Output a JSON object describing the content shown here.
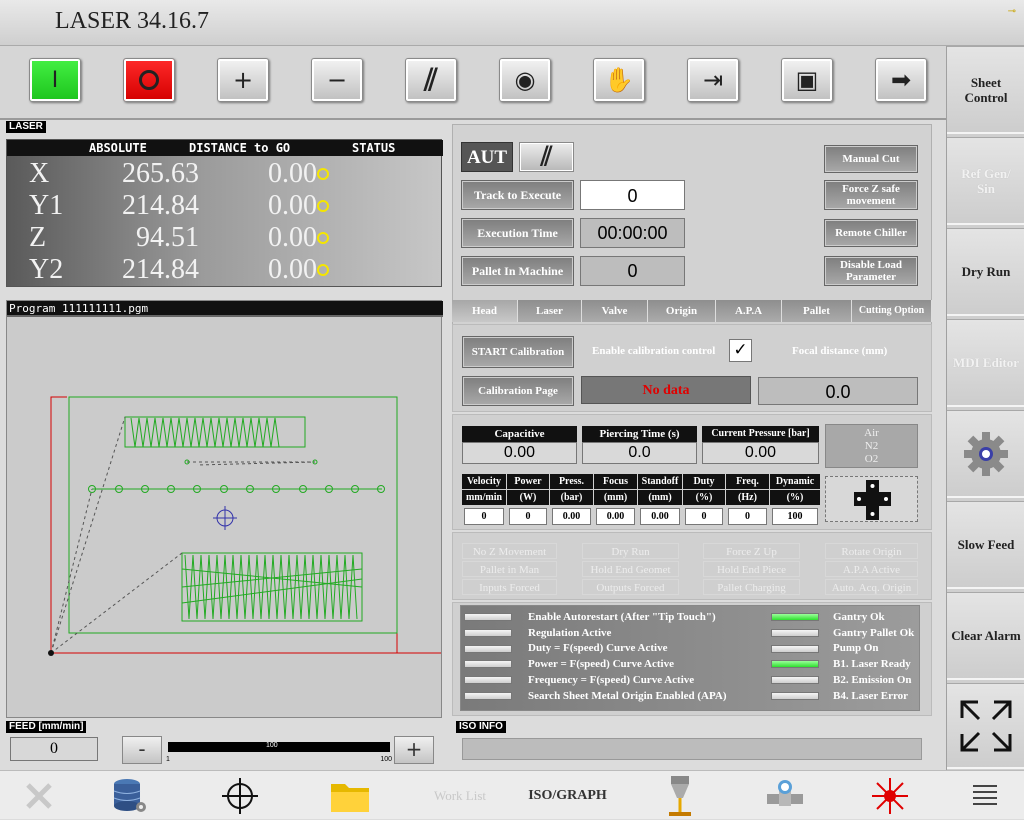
{
  "app": {
    "title": "LASER 34.16.7"
  },
  "toolbar": {
    "buttons": [
      {
        "name": "start-button",
        "glyph": "I"
      },
      {
        "name": "stop-button",
        "glyph": "O"
      },
      {
        "name": "plus-button",
        "glyph": "+"
      },
      {
        "name": "minus-button",
        "glyph": "−"
      },
      {
        "name": "slash-button",
        "glyph": "⫽"
      },
      {
        "name": "origin-button",
        "glyph": "◉"
      },
      {
        "name": "hand-button",
        "glyph": "✋"
      },
      {
        "name": "step-button",
        "glyph": "⇥"
      },
      {
        "name": "hand-exit-button",
        "glyph": "▶"
      },
      {
        "name": "exit-button",
        "glyph": "➜"
      }
    ]
  },
  "right_sidebar": [
    {
      "label": "Sheet\nControl",
      "enabled": true
    },
    {
      "label": "Ref Gen/\nSin",
      "enabled": false
    },
    {
      "label": "Dry Run",
      "enabled": true
    },
    {
      "label": "MDI Editor",
      "enabled": false
    },
    {
      "label": "",
      "icon": "gear-icon",
      "enabled": true
    },
    {
      "label": "Slow Feed",
      "enabled": true
    },
    {
      "label": "Clear Alarm",
      "enabled": true
    },
    {
      "label": "",
      "icon": "expand-icon",
      "enabled": true
    }
  ],
  "laser_panel": {
    "title": "LASER",
    "headers": [
      "ABSOLUTE",
      "DISTANCE to GO",
      "STATUS"
    ],
    "axes": [
      {
        "name": "X",
        "abs": "265.63",
        "dist": "0.00"
      },
      {
        "name": "Y1",
        "abs": "214.84",
        "dist": "0.00"
      },
      {
        "name": "Z",
        "abs": "94.51",
        "dist": "0.00"
      },
      {
        "name": "Y2",
        "abs": "214.84",
        "dist": "0.00"
      }
    ],
    "status_color": "#f5e600"
  },
  "program": {
    "title": "Program 111111111.pgm"
  },
  "feed": {
    "label": "FEED [mm/min]",
    "value": "0",
    "minus": "-",
    "plus": "+",
    "slider_value": "100",
    "slider_min": "1",
    "slider_max": "100"
  },
  "exec": {
    "mode": "AUT",
    "track_label": "Track to Execute",
    "track_value": "0",
    "time_label": "Execution Time",
    "time_value": "00:00:00",
    "pallet_label": "Pallet In Machine",
    "pallet_value": "0",
    "buttons": [
      "Manual Cut",
      "Force Z safe movement",
      "Remote Chiller",
      "Disable Load Parameter"
    ]
  },
  "tabs": [
    "Head",
    "Laser",
    "Valve",
    "Origin",
    "A.P.A",
    "Pallet",
    "Cutting Option"
  ],
  "head": {
    "start_cal": "START Calibration",
    "enable_cal": "Enable calibration control",
    "enable_cal_checked": true,
    "focal_label": "Focal distance (mm)",
    "cal_page": "Calibration Page",
    "no_data": "No data",
    "focal_value": "0.0"
  },
  "sensors": {
    "capacitive_label": "Capacitive",
    "capacitive": "0.00",
    "piercing_label": "Piercing Time (s)",
    "piercing": "0.0",
    "pressure_label": "Current Pressure [bar]",
    "pressure": "0.00",
    "gases": [
      "Air",
      "N2",
      "O2"
    ]
  },
  "params": {
    "headers": [
      [
        "Velocity",
        "mm/min"
      ],
      [
        "Power",
        "(W)"
      ],
      [
        "Press.",
        "(bar)"
      ],
      [
        "Focus",
        "(mm)"
      ],
      [
        "Standoff",
        "(mm)"
      ],
      [
        "Duty",
        "(%)"
      ],
      [
        "Freq.",
        "(Hz)"
      ],
      [
        "Dynamic",
        "(%)"
      ]
    ],
    "values": [
      "0",
      "0",
      "0.00",
      "0.00",
      "0.00",
      "0",
      "0",
      "100"
    ]
  },
  "options": [
    [
      "No Z Movement",
      "Dry Run",
      "Force Z Up",
      "Rotate Origin"
    ],
    [
      "Pallet in Man",
      "Hold End Geomet",
      "Hold End Piece",
      "A.P.A  Active"
    ],
    [
      "Inputs Forced",
      "Outputs Forced",
      "Pallet Charging",
      "Auto. Acq. Origin"
    ]
  ],
  "status_left": [
    {
      "label": "Enable Autorestart (After \"Tip Touch\")",
      "on": false
    },
    {
      "label": "Regulation Active",
      "on": false
    },
    {
      "label": "Duty = F(speed) Curve Active",
      "on": false
    },
    {
      "label": "Power = F(speed) Curve Active",
      "on": false
    },
    {
      "label": "Frequency = F(speed) Curve Active",
      "on": false
    },
    {
      "label": "Search Sheet Metal Origin Enabled (APA)",
      "on": false
    }
  ],
  "status_right": [
    {
      "label": "Gantry Ok",
      "on": true
    },
    {
      "label": "Gantry Pallet Ok",
      "on": false
    },
    {
      "label": "Pump On",
      "on": false
    },
    {
      "label": "B1. Laser Ready",
      "on": true
    },
    {
      "label": "B2. Emission On",
      "on": false
    },
    {
      "label": "B4. Laser Error",
      "on": false
    }
  ],
  "iso": {
    "label": "ISO INFO"
  },
  "bottom": [
    {
      "name": "close-button",
      "label": "",
      "icon": "close-icon"
    },
    {
      "name": "database-button",
      "label": "",
      "icon": "database-icon"
    },
    {
      "name": "crosshair-button",
      "label": "",
      "icon": "crosshair-icon"
    },
    {
      "name": "folder-button",
      "label": "",
      "icon": "folder-icon"
    },
    {
      "name": "worklist-button",
      "label": "Work List",
      "icon": ""
    },
    {
      "name": "isograph-button",
      "label": "ISO/GRAPH",
      "icon": ""
    },
    {
      "name": "nozzle-button",
      "label": "",
      "icon": "nozzle-icon"
    },
    {
      "name": "valve-button",
      "label": "",
      "icon": "valve-icon"
    },
    {
      "name": "laser-button",
      "label": "",
      "icon": "laser-icon"
    },
    {
      "name": "list-button",
      "label": "",
      "icon": "list-icon"
    }
  ],
  "colors": {
    "led_on": "#2ee02e",
    "start": "#22d022",
    "stop": "#e00000",
    "program_path": "#22aa22",
    "frame": "#d40000",
    "no_data": "#e00000"
  }
}
